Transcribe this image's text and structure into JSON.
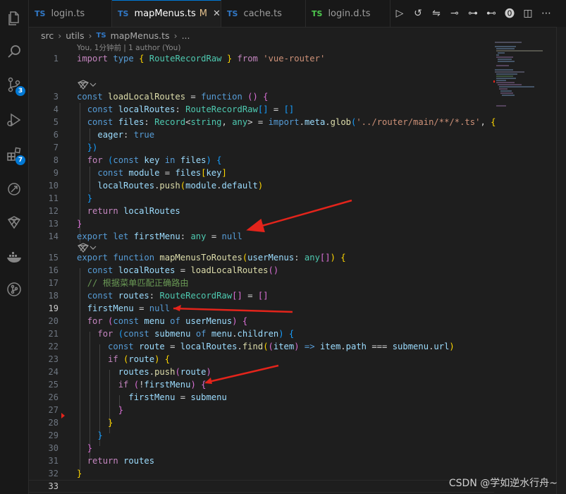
{
  "tabs": [
    {
      "icon": "TS",
      "label": "login.ts",
      "active": false
    },
    {
      "icon": "TS",
      "label": "mapMenus.ts",
      "modified": "M",
      "active": true
    },
    {
      "icon": "TS",
      "label": "cache.ts",
      "active": false
    },
    {
      "icon": "TS",
      "label": "login.d.ts",
      "active": false
    }
  ],
  "activity": {
    "badges": {
      "source_control": "3",
      "extensions": "7"
    },
    "icons": [
      "files-icon",
      "search-icon",
      "source-control-icon",
      "run-debug-icon",
      "extensions-icon",
      "remote-explorer-icon",
      "gitlens-icon",
      "docker-icon",
      "git-graph-icon"
    ]
  },
  "breadcrumb": {
    "parts": [
      "src",
      "utils",
      "mapMenus.ts",
      "..."
    ],
    "ts_icon": "TS"
  },
  "codelens": "You, 1分钟前 | 1 author (You)",
  "lines": [
    {
      "n": "1"
    },
    {
      "n": "3"
    },
    {
      "n": "4"
    },
    {
      "n": "5"
    },
    {
      "n": "6"
    },
    {
      "n": "7"
    },
    {
      "n": "8"
    },
    {
      "n": "9"
    },
    {
      "n": "10"
    },
    {
      "n": "11"
    },
    {
      "n": "12"
    },
    {
      "n": "13"
    },
    {
      "n": "14"
    },
    {
      "n": "15"
    },
    {
      "n": "16"
    },
    {
      "n": "17"
    },
    {
      "n": "18"
    },
    {
      "n": "19"
    },
    {
      "n": "20"
    },
    {
      "n": "21"
    },
    {
      "n": "22"
    },
    {
      "n": "23"
    },
    {
      "n": "24"
    },
    {
      "n": "25"
    },
    {
      "n": "26"
    },
    {
      "n": "27"
    },
    {
      "n": "28"
    },
    {
      "n": "29"
    },
    {
      "n": "30"
    },
    {
      "n": "31"
    },
    {
      "n": "32"
    },
    {
      "n": "33"
    }
  ],
  "code": {
    "l1": {
      "import": "import",
      "type": "type",
      "ob": "{",
      "name": "RouteRecordRaw",
      "cb": "}",
      "from": "from",
      "str": "'vue-router'"
    },
    "l3": {
      "const": "const",
      "name": "loadLocalRoutes",
      "eq": " = ",
      "fn": "function",
      "p": " ()",
      "ob": " {"
    },
    "l4": {
      "const": "const",
      "name": "localRoutes",
      "colon": ": ",
      "type": "RouteRecordRaw",
      "arr": "[]",
      "eq": " = ",
      "val": "[]"
    },
    "l5": {
      "const": "const",
      "name": "files",
      "colon": ": ",
      "type": "Record",
      "lt": "<",
      "t1": "string",
      "comma": ", ",
      "t2": "any",
      "gt": ">",
      "eq": " = ",
      "obj": "import",
      "dot1": ".",
      "meta": "meta",
      "dot2": ".",
      "glob": "glob",
      "op": "(",
      "str": "'../router/main/**/*.ts'",
      "rest": ", ",
      "ob": "{"
    },
    "l6": {
      "key": "eager",
      "colon": ": ",
      "val": "true"
    },
    "l7": {
      "cb": "})"
    },
    "l8": {
      "for": "for",
      "op": " (",
      "const": "const",
      "key": "key",
      "in": "in",
      "files": "files",
      "cp": ")",
      "ob": " {"
    },
    "l9": {
      "const": "const",
      "name": "module",
      "eq": " = ",
      "files": "files",
      "ob": "[",
      "key": "key",
      "cb": "]"
    },
    "l10": {
      "obj": "localRoutes",
      "dot": ".",
      "fn": "push",
      "op": "(",
      "arg": "module",
      "dot2": ".",
      "prop": "default",
      "cp": ")"
    },
    "l11": {
      "cb": "}"
    },
    "l12": {
      "ret": "return",
      "val": "localRoutes"
    },
    "l13": {
      "cb": "}"
    },
    "l14": {
      "export": "export",
      "let": "let",
      "name": "firstMenu",
      "colon": ": ",
      "type": "any",
      "eq": " = ",
      "val": "null"
    },
    "l15": {
      "export": "export",
      "fn": "function",
      "name": "mapMenusToRoutes",
      "op": "(",
      "arg": "userMenus",
      "colon": ": ",
      "type": "any",
      "arr": "[]",
      "cp": ")",
      "ob": " {"
    },
    "l16": {
      "const": "const",
      "name": "localRoutes",
      "eq": " = ",
      "fn": "loadLocalRoutes",
      "p": "()"
    },
    "l17": {
      "comment": "// 根据菜单匹配正确路由"
    },
    "l18": {
      "const": "const",
      "name": "routes",
      "colon": ": ",
      "type": "RouteRecordRaw",
      "arr": "[]",
      "eq": " = ",
      "val": "[]"
    },
    "l19": {
      "name": "firstMenu",
      "eq": " = ",
      "val": "null"
    },
    "l20": {
      "for": "for",
      "op": " (",
      "const": "const",
      "name": "menu",
      "of": "of",
      "src": "userMenus",
      "cp": ")",
      "ob": " {"
    },
    "l21": {
      "for": "for",
      "op": " (",
      "const": "const",
      "name": "submenu",
      "of": "of",
      "src": "menu",
      "dot": ".",
      "prop": "children",
      "cp": ")",
      "ob": " {"
    },
    "l22": {
      "const": "const",
      "name": "route",
      "eq": " = ",
      "obj": "localRoutes",
      "dot": ".",
      "fn": "find",
      "op": "(",
      "op2": "(",
      "arg": "item",
      "cp2": ")",
      "arrow": " => ",
      "o2": "item",
      "dot2": ".",
      "p2": "path",
      "eqeq": " === ",
      "o3": "submenu",
      "dot3": ".",
      "p3": "url",
      "cp": ")"
    },
    "l23": {
      "if": "if",
      "op": " (",
      "name": "route",
      "cp": ")",
      "ob": " {"
    },
    "l24": {
      "obj": "routes",
      "dot": ".",
      "fn": "push",
      "op": "(",
      "arg": "route",
      "cp": ")"
    },
    "l25": {
      "if": "if",
      "op": " (",
      "not": "!",
      "name": "firstMenu",
      "cp": ")",
      "ob": " {"
    },
    "l26": {
      "name": "firstMenu",
      "eq": " = ",
      "val": "submenu"
    },
    "l27": {
      "cb": "}"
    },
    "l28": {
      "cb": "}"
    },
    "l29": {
      "cb": "}"
    },
    "l30": {
      "cb": "}"
    },
    "l31": {
      "ret": "return",
      "val": "routes"
    },
    "l32": {
      "cb": "}"
    }
  },
  "watermark": "CSDN @学如逆水行舟~",
  "colors": {
    "accent": "#0078d4",
    "arrow": "#e3241b"
  }
}
